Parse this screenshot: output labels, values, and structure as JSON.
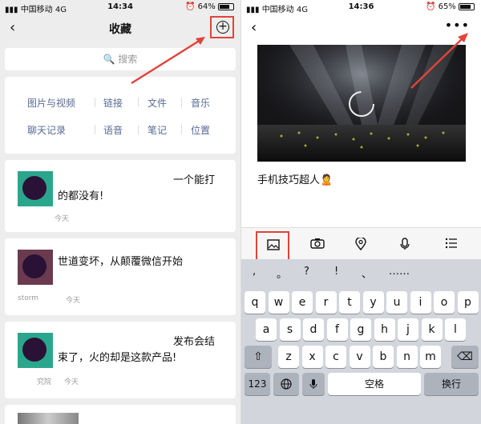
{
  "left": {
    "status": {
      "carrier": "中国移动",
      "net": "4G",
      "time": "14:34",
      "battery": "64%"
    },
    "nav": {
      "back": "‹",
      "title": "收藏",
      "add": "+"
    },
    "search_placeholder": "搜索",
    "categories": [
      "图片与视频",
      "链接",
      "文件",
      "音乐",
      "聊天记录",
      "语音",
      "笔记",
      "位置"
    ],
    "items": [
      {
        "text1": "一个能打",
        "text2": "的都没有!",
        "meta": "今天"
      },
      {
        "text1": "世道变坏，从颠覆微信开始",
        "source": "storm",
        "meta": "今天"
      },
      {
        "text1": "发布会结",
        "text2": "束了，火的却是这款产品!",
        "source": "究院",
        "meta": "今天"
      }
    ]
  },
  "right": {
    "status": {
      "carrier": "中国移动",
      "net": "4G",
      "time": "14:36",
      "battery": "65%"
    },
    "nav": {
      "back": "‹",
      "more": "•••"
    },
    "note_title": "手机技巧超人🙎",
    "punct_keys": [
      ",",
      "。",
      "?",
      "!",
      "、",
      "……"
    ],
    "row1": [
      "q",
      "w",
      "e",
      "r",
      "t",
      "y",
      "u",
      "i",
      "o",
      "p"
    ],
    "row2": [
      "a",
      "s",
      "d",
      "f",
      "g",
      "h",
      "j",
      "k",
      "l"
    ],
    "row3": [
      "z",
      "x",
      "c",
      "v",
      "b",
      "n",
      "m"
    ],
    "key_123": "123",
    "key_space": "空格",
    "key_return": "换行"
  }
}
